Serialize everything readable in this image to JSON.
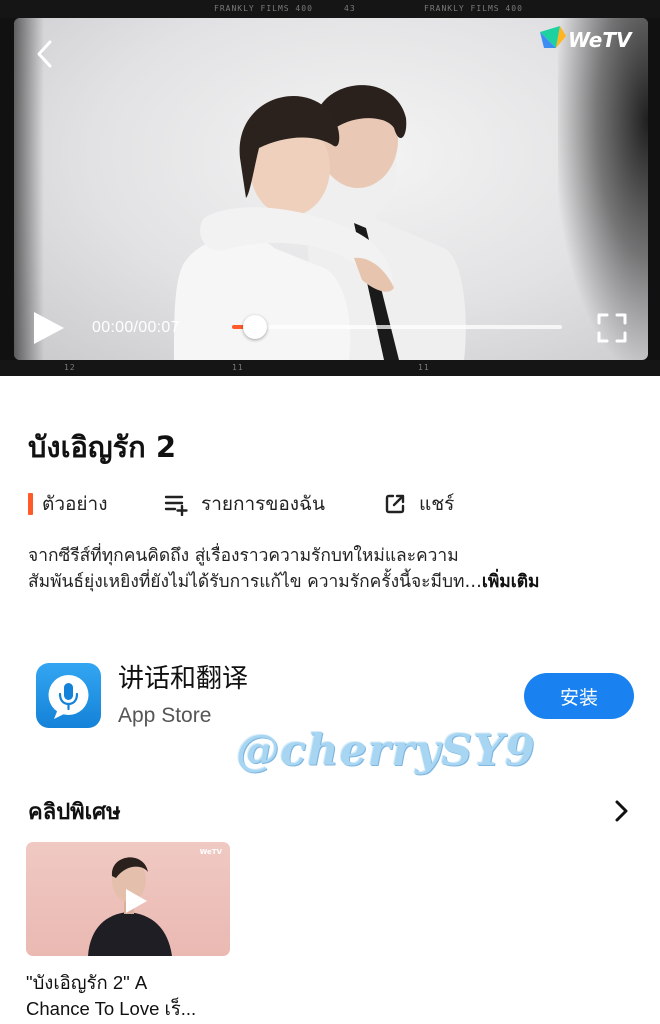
{
  "player": {
    "logo_text": "WeTV",
    "film_marks_top": [
      "FRANKLY FILMS 400",
      "43",
      "FRANKLY FILMS 400"
    ],
    "film_marks_bottom": [
      "12",
      "11",
      "11"
    ],
    "time": "00:00/00:07",
    "progress": 0.07,
    "accent_color": "#ff5a2a"
  },
  "details": {
    "title": "บังเอิญรัก 2",
    "actions": {
      "trailer": "ตัวอย่าง",
      "my_list": "รายการของฉัน",
      "share": "แชร์"
    },
    "description_line1": "จากซีรีส์ที่ทุกคนคิดถึง สู่เรื่องราวความรักบทใหม่และความ",
    "description_line2": "สัมพันธ์ยุ่งเหยิงที่ยังไม่ได้รับการแก้ไข ความรักครั้งนี้จะมีบท…",
    "more_label": "เพิ่มเติม"
  },
  "ad": {
    "app_name": "讲话和翻译",
    "store": "App Store",
    "install_label": "安装",
    "icon": "microphone-icon",
    "button_color": "#1a82f0"
  },
  "watermark": "@cherrySY9",
  "special": {
    "title": "คลิปพิเศษ",
    "clip": {
      "thumb_logo": "WeTV",
      "caption_line1": "\"บังเอิญรัก 2\" A",
      "caption_line2": "Chance To Love เร็..."
    }
  }
}
